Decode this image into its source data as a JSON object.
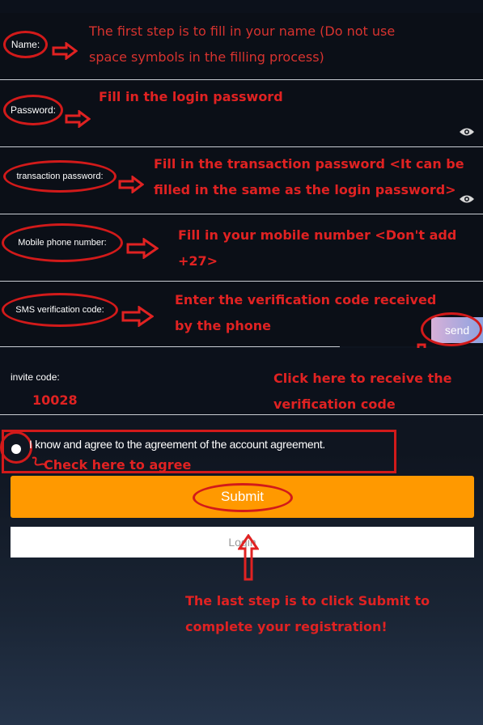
{
  "colors": {
    "annotation_red": "#e02222",
    "submit_orange": "#ff9900",
    "field_bg": "#0b0f17",
    "send_gradient_start": "#d7b0d8",
    "send_gradient_end": "#8da3e0"
  },
  "form": {
    "name": {
      "label": "Name:",
      "note_line1": "The first step is to fill in your name (Do not use",
      "note_line2": "space symbols in the filling process)"
    },
    "password": {
      "label": "Password:",
      "note": "Fill in the login password",
      "eye_icon": "eye-icon"
    },
    "transaction_password": {
      "label": "transaction password:",
      "note_line1": "Fill in the transaction password <It can be",
      "note_line2": "filled in the same as the login password>",
      "eye_icon": "eye-icon"
    },
    "mobile": {
      "label": "Mobile phone number:",
      "note_line1": "Fill in your mobile number  <Don't add",
      "note_line2": "+27>"
    },
    "sms": {
      "label": "SMS verification code:",
      "note_line1": "Enter the verification code received",
      "note_line2": "by the phone",
      "send_label": "send"
    },
    "invite": {
      "label": "invite code:",
      "value": "10028",
      "note_line1": "Click here to receive the",
      "note_line2": "verification code"
    }
  },
  "agreement": {
    "text": "I know and agree to the agreement of the account agreement.",
    "note": "Check here to agree"
  },
  "buttons": {
    "submit_label": "Submit",
    "login_label": "Login"
  },
  "footer_note": {
    "line1": "The last step is to click Submit to",
    "line2": "complete your registration!"
  }
}
